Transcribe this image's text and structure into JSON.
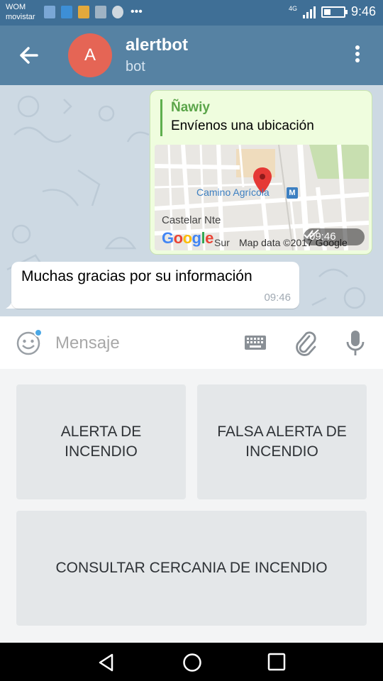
{
  "status_bar": {
    "carrier_line1": "WOM",
    "carrier_line2": "movistar",
    "network": "4G",
    "battery_level": 0.35,
    "time": "9:46"
  },
  "header": {
    "avatar_letter": "A",
    "title": "alertbot",
    "subtitle": "bot",
    "colors": {
      "header": "#5682a3",
      "avatar": "#e56555"
    }
  },
  "messages": {
    "outgoing": {
      "reply_name": "Ñawiy",
      "reply_text": "Envíenos una ubicación",
      "map": {
        "place_label": "Camino Agrícola",
        "metro_label": "M",
        "street_label": "Castelar Nte",
        "google_logo": [
          "G",
          "o",
          "o",
          "g",
          "l",
          "e"
        ],
        "sur_label": "Sur",
        "attribution": "Map data ©2017 Google"
      },
      "time": "09:46",
      "status": "read"
    },
    "incoming": {
      "text": "Muchas gracias por su información",
      "time": "09:46"
    }
  },
  "compose": {
    "placeholder": "Mensaje",
    "value": ""
  },
  "keyboard": {
    "buttons": [
      {
        "label": "ALERTA DE INCENDIO"
      },
      {
        "label": "FALSA ALERTA DE INCENDIO"
      },
      {
        "label": "CONSULTAR CERCANIA DE INCENDIO"
      }
    ]
  },
  "icons": {
    "back": "arrow-left-icon",
    "menu": "more-vertical-icon",
    "emoji": "smile-icon",
    "keyboard": "keyboard-icon",
    "attach": "paperclip-icon",
    "mic": "microphone-icon",
    "nav_back": "triangle-back-icon",
    "nav_home": "circle-home-icon",
    "nav_recent": "square-recents-icon"
  }
}
